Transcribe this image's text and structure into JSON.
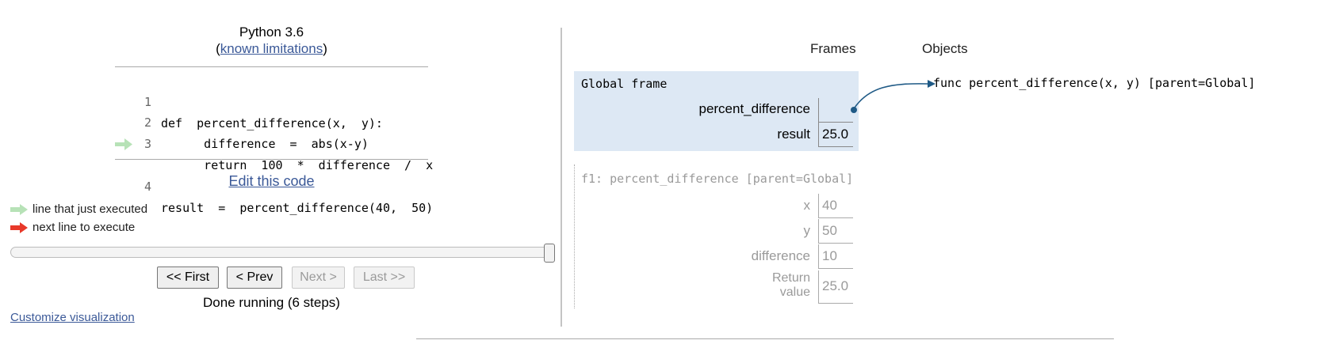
{
  "header": {
    "language": "Python 3.6",
    "limitations_prefix": "(",
    "limitations_link": "known limitations",
    "limitations_suffix": ")"
  },
  "code": {
    "lines": [
      {
        "number": "1",
        "text": "def  percent_difference(x,  y):"
      },
      {
        "number": "2",
        "text": "      difference  =  abs(x-y)"
      },
      {
        "number": "3",
        "text": "      return  100  *  difference  /  x"
      },
      {
        "number": "4",
        "text": "result  =  percent_difference(40,  50)"
      }
    ],
    "current_line": 4,
    "edit_link": "Edit this code"
  },
  "legend": {
    "just_executed": "line that just executed",
    "next_line": "next line to execute"
  },
  "navigation": {
    "first": "<< First",
    "prev": "< Prev",
    "next": "Next >",
    "last": "Last >>",
    "status": "Done running (6 steps)",
    "slider_position": 1.0
  },
  "customize_link": "Customize visualization",
  "visualization": {
    "frames_label": "Frames",
    "objects_label": "Objects",
    "global_frame": {
      "title": "Global frame",
      "vars": [
        {
          "name": "percent_difference",
          "value": ""
        },
        {
          "name": "result",
          "value": "25.0"
        }
      ]
    },
    "f1_frame": {
      "title": "f1: percent_difference [parent=Global]",
      "vars": [
        {
          "name": "x",
          "value": "40"
        },
        {
          "name": "y",
          "value": "50"
        },
        {
          "name": "difference",
          "value": "10"
        }
      ],
      "return_label_line1": "Return",
      "return_label_line2": "value",
      "return_value": "25.0"
    },
    "function_object": "func percent_difference(x,  y) [parent=Global]"
  },
  "colors": {
    "link": "#3b5998",
    "frame_bg": "#dde8f4",
    "arrow_just_executed": "#b7e2b7",
    "arrow_next": "#e8392a",
    "pointer": "#1f5a86"
  }
}
